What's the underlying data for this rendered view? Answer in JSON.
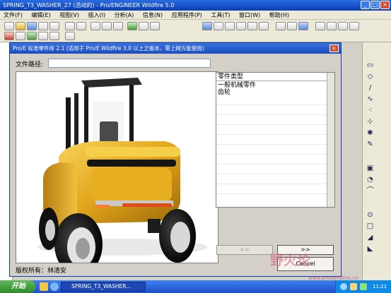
{
  "window": {
    "title": "SPRING_T3_WASHER_27 (活动的) - Pro/ENGINEER Wildfire 5.0",
    "buttons": [
      "_",
      "□",
      "×"
    ]
  },
  "menu": [
    "文件(F)",
    "编辑(E)",
    "视图(V)",
    "插入(I)",
    "分析(A)",
    "信息(N)",
    "应用程序(P)",
    "工具(T)",
    "窗口(W)",
    "帮助(H)"
  ],
  "dialog": {
    "title": "Pro/E 标准零件库 2.1 (适用于 Pro/E Wildfire 3.0 以上之版本，需上网方能使用)",
    "close": "×",
    "path_label": "文件路径:",
    "path_value": "",
    "copyright": "版权所有：林清安",
    "list": {
      "header": "零件类型",
      "items": [
        "一般机械零件",
        "齿轮"
      ]
    },
    "prev_label": "<<",
    "next_label": ">>",
    "cancel_label": "Cancel"
  },
  "taskbar": {
    "start": "开始",
    "task": "SPRING_T3_WASHER...",
    "clock": "11:21"
  },
  "watermark": {
    "text": "野火论",
    "url": "www.proewildfire.cn"
  },
  "colors": {
    "title_blue": "#0a3fb5",
    "forklift_yellow": "#e3a51c",
    "taskbar_blue": "#245edb",
    "start_green": "#3c9b36"
  },
  "icons": [
    "new-icon",
    "open-icon",
    "save-icon",
    "print-icon",
    "email-icon",
    "undo-icon",
    "redo-icon",
    "cut-icon",
    "copy-icon",
    "paste-icon",
    "regenerate-icon",
    "find-icon",
    "select-icon",
    "repaint-icon",
    "zoom-in-icon",
    "zoom-out-icon",
    "refit-icon",
    "orient-icon",
    "saved-views-icon",
    "wireframe-icon",
    "hidden-line-icon",
    "shading-icon",
    "datum-plane-icon",
    "datum-axis-icon",
    "datum-point-icon",
    "csys-icon"
  ]
}
